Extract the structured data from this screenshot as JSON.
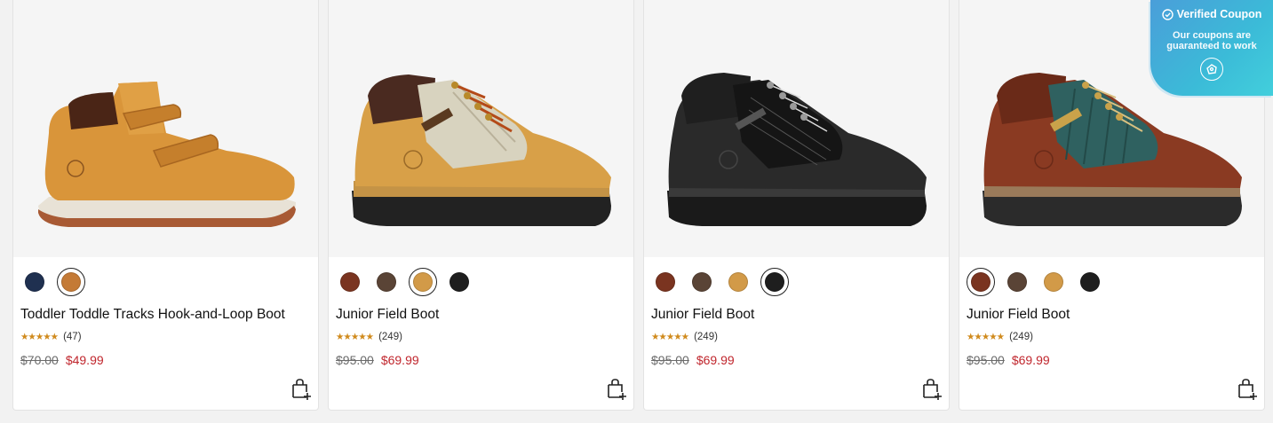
{
  "products": [
    {
      "name": "Toddler Toddle Tracks Hook-and-Loop Boot",
      "stars": "★★★★★",
      "reviews": "(47)",
      "old_price": "$70.00",
      "new_price": "$49.99",
      "image": "toddler-hook-and-loop-boot-wheat",
      "swatches": [
        "#1f3050",
        "#c47a36"
      ],
      "selected": 1
    },
    {
      "name": "Junior Field Boot",
      "stars": "★★★★★",
      "reviews": "(249)",
      "old_price": "$95.00",
      "new_price": "$69.99",
      "image": "junior-field-boot-wheat",
      "swatches": [
        "#7a3420",
        "#5a4436",
        "#d29a48",
        "#1e1e1e"
      ],
      "selected": 2
    },
    {
      "name": "Junior Field Boot",
      "stars": "★★★★★",
      "reviews": "(249)",
      "old_price": "$95.00",
      "new_price": "$69.99",
      "image": "junior-field-boot-black",
      "swatches": [
        "#7a3420",
        "#5a4436",
        "#d29a48",
        "#1e1e1e"
      ],
      "selected": 3
    },
    {
      "name": "Junior Field Boot",
      "stars": "★★★★★",
      "reviews": "(249)",
      "old_price": "$95.00",
      "new_price": "$69.99",
      "image": "junior-field-boot-brown-green",
      "swatches": [
        "#7a3420",
        "#5a4436",
        "#d29a48",
        "#1e1e1e"
      ],
      "selected": 0
    }
  ],
  "coupon": {
    "title": "Verified Coupon",
    "subtitle_line1": "Our coupons are",
    "subtitle_line2": "guaranteed to work"
  },
  "icons": {
    "add_to_bag": "shopping-bag-plus-icon",
    "verified": "check-circle-icon",
    "coupon_logo": "coupon-logo-icon"
  },
  "colors": {
    "sale_price": "#c0262d",
    "star": "#d08a1c",
    "coupon_bg": "#3bbbd8"
  }
}
